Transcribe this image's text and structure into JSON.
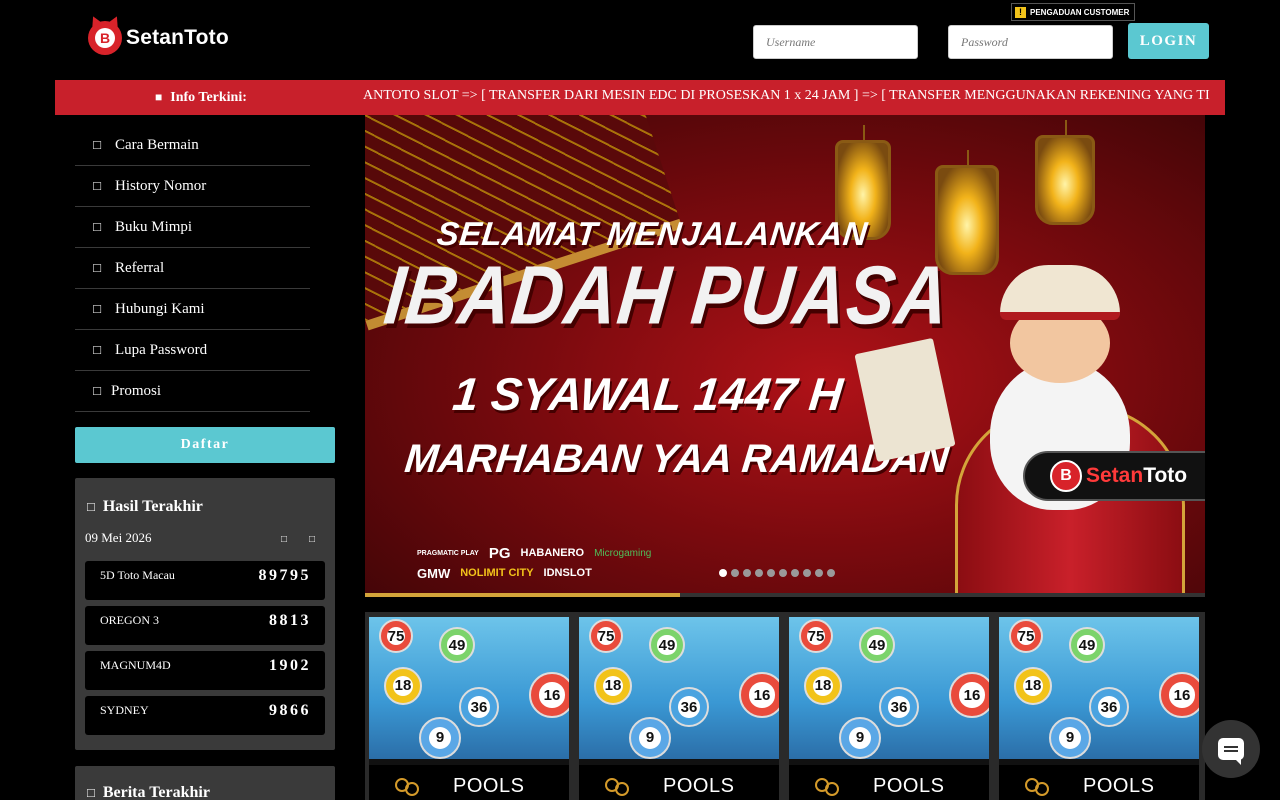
{
  "header": {
    "logo_text": "SetanToto",
    "logo_badge": "B",
    "pengaduan_label": "PENGADUAN CUSTOMER",
    "username_placeholder": "Username",
    "password_placeholder": "Password",
    "login_label": "LOGIN"
  },
  "info_bar": {
    "label": "Info Terkini:",
    "marquee": "ANTOTO SLOT => [ TRANSFER DARI MESIN EDC DI PROSESKAN 1 x 24 JAM ] => [ TRANSFER MENGGUNAKAN REKENING YANG TIDAK TERDAFTAR ]"
  },
  "sidebar": {
    "items": [
      {
        "label": "Cara Bermain",
        "icon": "info-icon"
      },
      {
        "label": "History Nomor",
        "icon": "history-icon"
      },
      {
        "label": "Buku Mimpi",
        "icon": "book-icon"
      },
      {
        "label": "Referral",
        "icon": "users-icon"
      },
      {
        "label": "Hubungi Kami",
        "icon": "phone-icon"
      },
      {
        "label": "Lupa Password",
        "icon": "key-icon"
      },
      {
        "label": "Promosi",
        "icon": "gift-icon"
      }
    ],
    "daftar_label": "Daftar"
  },
  "hasil": {
    "title": "Hasil Terakhir",
    "date": "09 Mei 2026",
    "results": [
      {
        "name": "5D Toto Macau",
        "number": "89795"
      },
      {
        "name": "OREGON 3",
        "number": "8813"
      },
      {
        "name": "MAGNUM4D",
        "number": "1902"
      },
      {
        "name": "SYDNEY",
        "number": "9866"
      }
    ]
  },
  "berita": {
    "title": "Berita Terakhir"
  },
  "banner": {
    "line1": "SELAMAT MENJALANKAN",
    "line2": "IBADAH PUASA",
    "line3": "1 SYAWAL 1447 H",
    "line4": "MARHABAN YAA RAMADAN",
    "logo_text_red": "Setan",
    "logo_text_white": "Toto",
    "providers_row1": [
      "PRAGMATIC PLAY",
      "PG",
      "HABANERO",
      "Microgaming"
    ],
    "providers_row2": [
      "GMW",
      "NOLIMIT CITY",
      "IDNSLOT"
    ],
    "slide_count": 10,
    "active_slide": 0,
    "progress": 0.375
  },
  "pools": {
    "cards": [
      {
        "label": "POOLS"
      },
      {
        "label": "POOLS"
      },
      {
        "label": "POOLS"
      },
      {
        "label": "POOLS"
      }
    ],
    "ball_numbers": [
      "75",
      "49",
      "18",
      "36",
      "9",
      "16"
    ]
  },
  "colors": {
    "accent_cyan": "#5bc8d1",
    "info_red": "#c8202b",
    "brand_red": "#d8232a",
    "gold": "#d4a43a",
    "panel_gray": "#3a3a3a"
  }
}
